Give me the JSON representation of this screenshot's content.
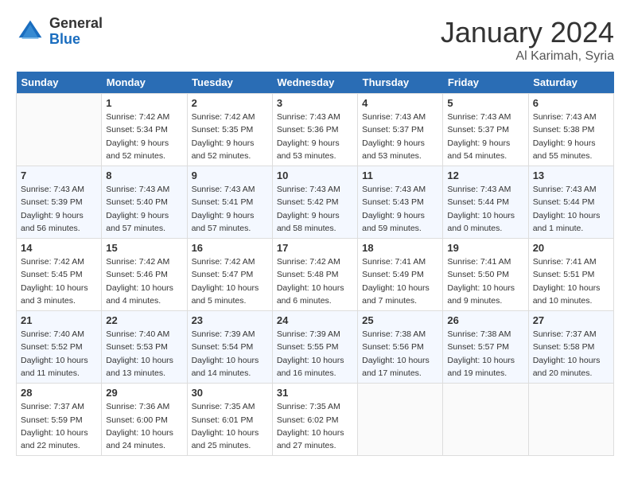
{
  "header": {
    "logo_general": "General",
    "logo_blue": "Blue",
    "month_title": "January 2024",
    "location": "Al Karimah, Syria"
  },
  "days_of_week": [
    "Sunday",
    "Monday",
    "Tuesday",
    "Wednesday",
    "Thursday",
    "Friday",
    "Saturday"
  ],
  "weeks": [
    [
      {
        "day": "",
        "info": ""
      },
      {
        "day": "1",
        "info": "Sunrise: 7:42 AM\nSunset: 5:34 PM\nDaylight: 9 hours\nand 52 minutes."
      },
      {
        "day": "2",
        "info": "Sunrise: 7:42 AM\nSunset: 5:35 PM\nDaylight: 9 hours\nand 52 minutes."
      },
      {
        "day": "3",
        "info": "Sunrise: 7:43 AM\nSunset: 5:36 PM\nDaylight: 9 hours\nand 53 minutes."
      },
      {
        "day": "4",
        "info": "Sunrise: 7:43 AM\nSunset: 5:37 PM\nDaylight: 9 hours\nand 53 minutes."
      },
      {
        "day": "5",
        "info": "Sunrise: 7:43 AM\nSunset: 5:37 PM\nDaylight: 9 hours\nand 54 minutes."
      },
      {
        "day": "6",
        "info": "Sunrise: 7:43 AM\nSunset: 5:38 PM\nDaylight: 9 hours\nand 55 minutes."
      }
    ],
    [
      {
        "day": "7",
        "info": "Sunrise: 7:43 AM\nSunset: 5:39 PM\nDaylight: 9 hours\nand 56 minutes."
      },
      {
        "day": "8",
        "info": "Sunrise: 7:43 AM\nSunset: 5:40 PM\nDaylight: 9 hours\nand 57 minutes."
      },
      {
        "day": "9",
        "info": "Sunrise: 7:43 AM\nSunset: 5:41 PM\nDaylight: 9 hours\nand 57 minutes."
      },
      {
        "day": "10",
        "info": "Sunrise: 7:43 AM\nSunset: 5:42 PM\nDaylight: 9 hours\nand 58 minutes."
      },
      {
        "day": "11",
        "info": "Sunrise: 7:43 AM\nSunset: 5:43 PM\nDaylight: 9 hours\nand 59 minutes."
      },
      {
        "day": "12",
        "info": "Sunrise: 7:43 AM\nSunset: 5:44 PM\nDaylight: 10 hours\nand 0 minutes."
      },
      {
        "day": "13",
        "info": "Sunrise: 7:43 AM\nSunset: 5:44 PM\nDaylight: 10 hours\nand 1 minute."
      }
    ],
    [
      {
        "day": "14",
        "info": "Sunrise: 7:42 AM\nSunset: 5:45 PM\nDaylight: 10 hours\nand 3 minutes."
      },
      {
        "day": "15",
        "info": "Sunrise: 7:42 AM\nSunset: 5:46 PM\nDaylight: 10 hours\nand 4 minutes."
      },
      {
        "day": "16",
        "info": "Sunrise: 7:42 AM\nSunset: 5:47 PM\nDaylight: 10 hours\nand 5 minutes."
      },
      {
        "day": "17",
        "info": "Sunrise: 7:42 AM\nSunset: 5:48 PM\nDaylight: 10 hours\nand 6 minutes."
      },
      {
        "day": "18",
        "info": "Sunrise: 7:41 AM\nSunset: 5:49 PM\nDaylight: 10 hours\nand 7 minutes."
      },
      {
        "day": "19",
        "info": "Sunrise: 7:41 AM\nSunset: 5:50 PM\nDaylight: 10 hours\nand 9 minutes."
      },
      {
        "day": "20",
        "info": "Sunrise: 7:41 AM\nSunset: 5:51 PM\nDaylight: 10 hours\nand 10 minutes."
      }
    ],
    [
      {
        "day": "21",
        "info": "Sunrise: 7:40 AM\nSunset: 5:52 PM\nDaylight: 10 hours\nand 11 minutes."
      },
      {
        "day": "22",
        "info": "Sunrise: 7:40 AM\nSunset: 5:53 PM\nDaylight: 10 hours\nand 13 minutes."
      },
      {
        "day": "23",
        "info": "Sunrise: 7:39 AM\nSunset: 5:54 PM\nDaylight: 10 hours\nand 14 minutes."
      },
      {
        "day": "24",
        "info": "Sunrise: 7:39 AM\nSunset: 5:55 PM\nDaylight: 10 hours\nand 16 minutes."
      },
      {
        "day": "25",
        "info": "Sunrise: 7:38 AM\nSunset: 5:56 PM\nDaylight: 10 hours\nand 17 minutes."
      },
      {
        "day": "26",
        "info": "Sunrise: 7:38 AM\nSunset: 5:57 PM\nDaylight: 10 hours\nand 19 minutes."
      },
      {
        "day": "27",
        "info": "Sunrise: 7:37 AM\nSunset: 5:58 PM\nDaylight: 10 hours\nand 20 minutes."
      }
    ],
    [
      {
        "day": "28",
        "info": "Sunrise: 7:37 AM\nSunset: 5:59 PM\nDaylight: 10 hours\nand 22 minutes."
      },
      {
        "day": "29",
        "info": "Sunrise: 7:36 AM\nSunset: 6:00 PM\nDaylight: 10 hours\nand 24 minutes."
      },
      {
        "day": "30",
        "info": "Sunrise: 7:35 AM\nSunset: 6:01 PM\nDaylight: 10 hours\nand 25 minutes."
      },
      {
        "day": "31",
        "info": "Sunrise: 7:35 AM\nSunset: 6:02 PM\nDaylight: 10 hours\nand 27 minutes."
      },
      {
        "day": "",
        "info": ""
      },
      {
        "day": "",
        "info": ""
      },
      {
        "day": "",
        "info": ""
      }
    ]
  ]
}
